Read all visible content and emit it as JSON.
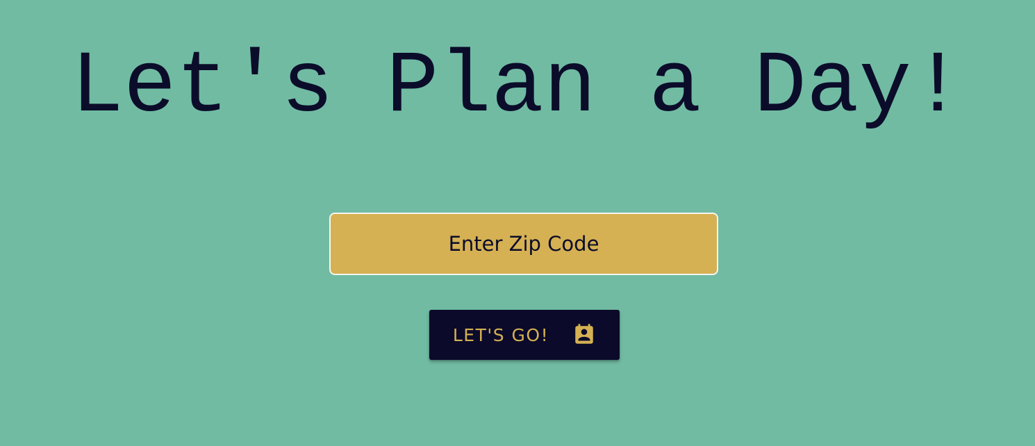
{
  "page": {
    "title": "Let's Plan a Day!"
  },
  "form": {
    "zip_placeholder": "Enter Zip Code",
    "zip_value": "",
    "submit_label": "LET'S GO!",
    "submit_icon": "contact-calendar-icon"
  },
  "colors": {
    "background": "#71bba3",
    "accent": "#d5b153",
    "dark": "#0b0a2a"
  }
}
